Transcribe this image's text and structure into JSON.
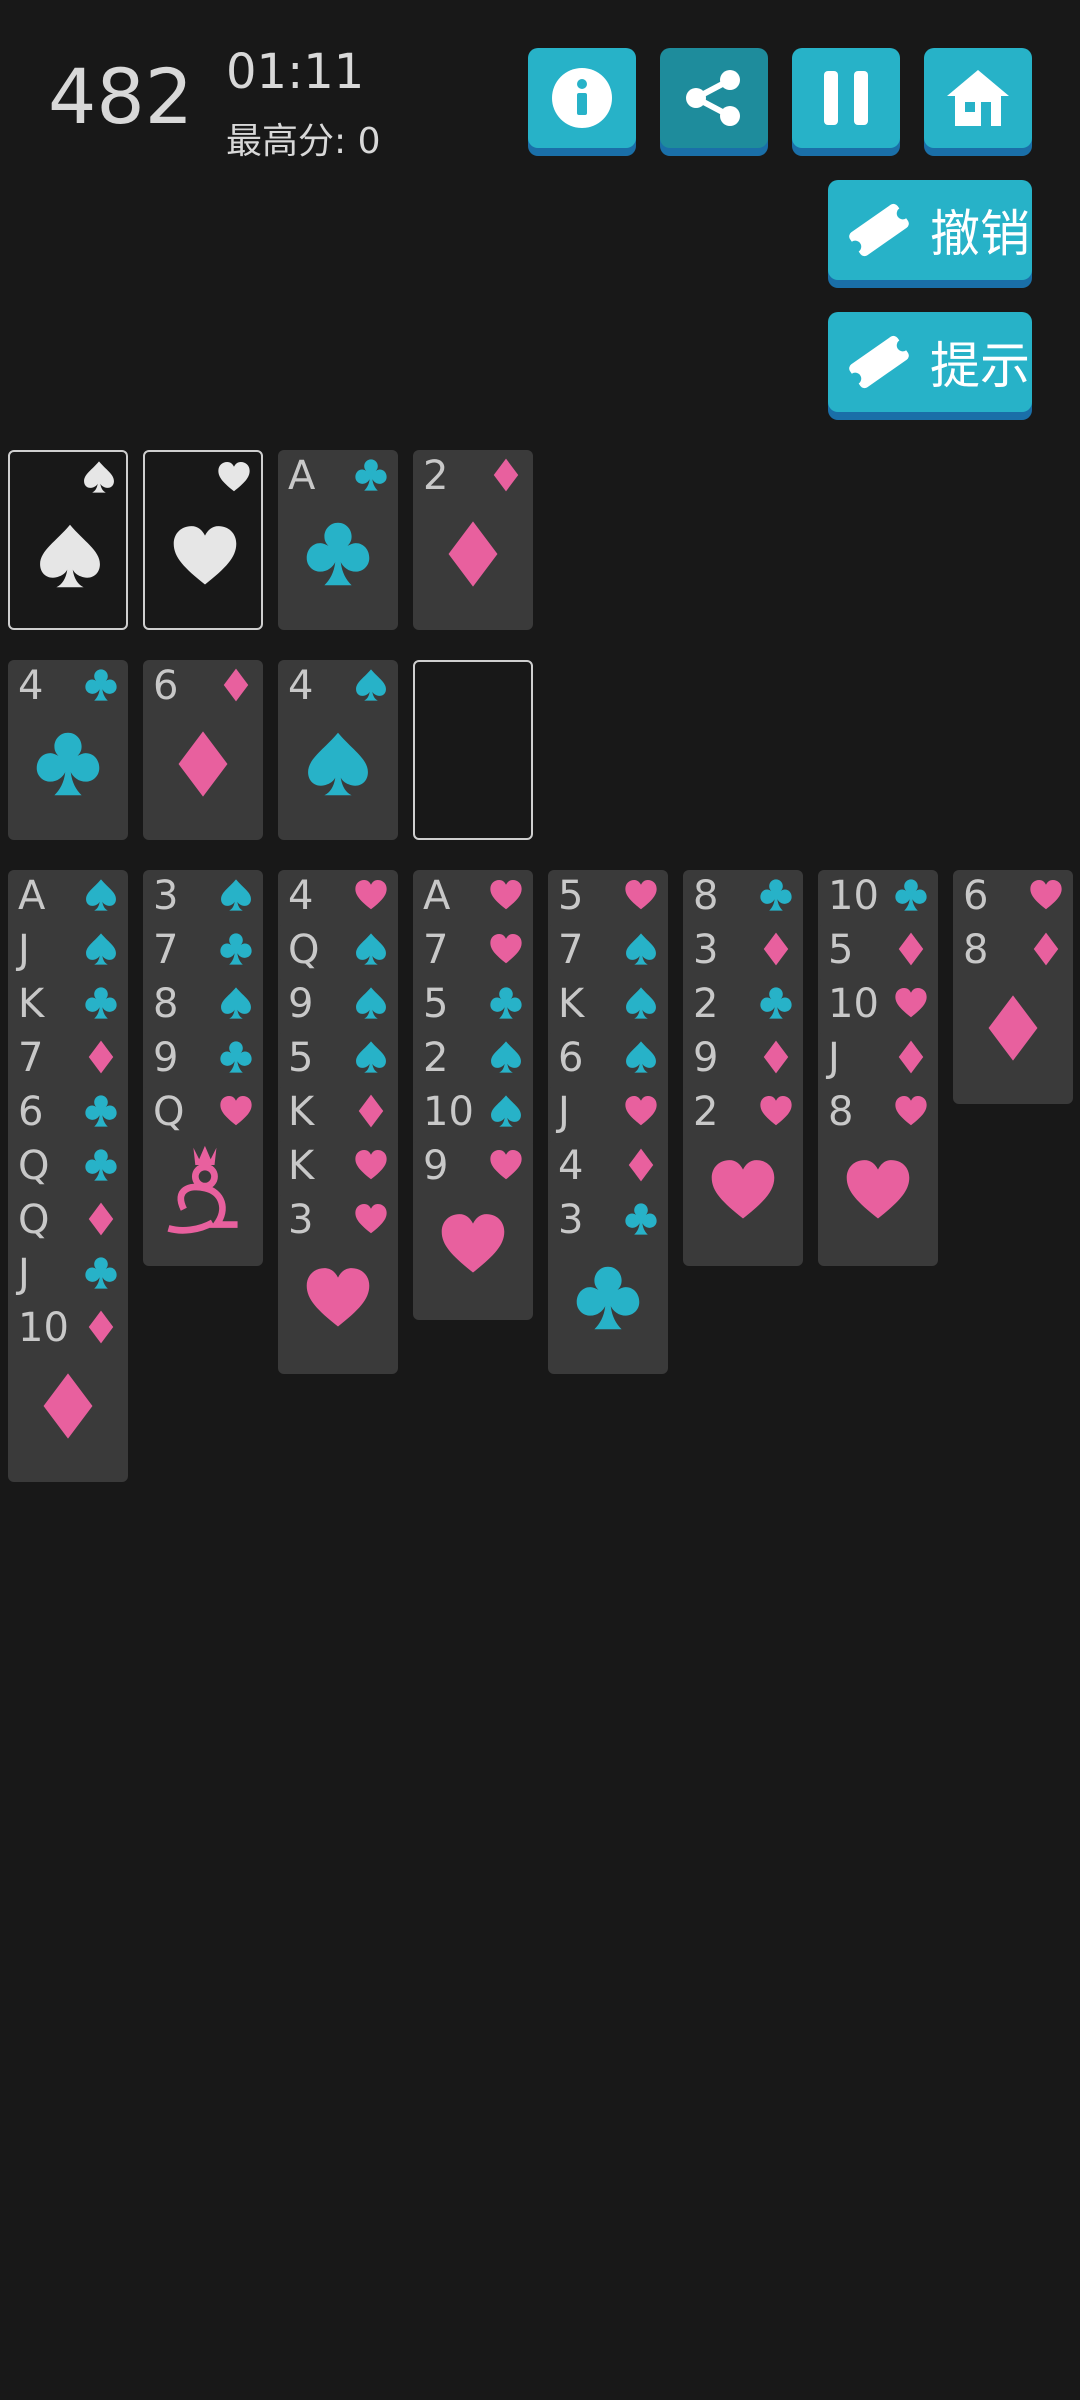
{
  "header": {
    "score": "482",
    "timer": "01:11",
    "best_score": "最高分:  0"
  },
  "toolbar": {
    "undo_label": "撤销",
    "hint_label": "提示"
  },
  "colors": {
    "teal": "#27b2c8",
    "pink": "#e8609e",
    "card": "#3a3a3a",
    "bg": "#181818"
  },
  "foundations": [
    {
      "rank": "",
      "suit": "spade",
      "placeholder": true
    },
    {
      "rank": "",
      "suit": "heart",
      "placeholder": true
    },
    {
      "rank": "A",
      "suit": "club"
    },
    {
      "rank": "2",
      "suit": "diamond"
    }
  ],
  "free_cells": [
    {
      "rank": "4",
      "suit": "club"
    },
    {
      "rank": "6",
      "suit": "diamond"
    },
    {
      "rank": "4",
      "suit": "spade"
    },
    {
      "empty": true
    }
  ],
  "tableau": [
    [
      {
        "rank": "A",
        "suit": "spade"
      },
      {
        "rank": "J",
        "suit": "spade"
      },
      {
        "rank": "K",
        "suit": "club"
      },
      {
        "rank": "7",
        "suit": "diamond"
      },
      {
        "rank": "6",
        "suit": "club"
      },
      {
        "rank": "Q",
        "suit": "club"
      },
      {
        "rank": "Q",
        "suit": "diamond"
      },
      {
        "rank": "J",
        "suit": "club"
      },
      {
        "rank": "10",
        "suit": "diamond"
      }
    ],
    [
      {
        "rank": "3",
        "suit": "spade"
      },
      {
        "rank": "7",
        "suit": "club"
      },
      {
        "rank": "8",
        "suit": "spade"
      },
      {
        "rank": "9",
        "suit": "club"
      },
      {
        "rank": "Q",
        "suit": "heart",
        "face": true
      }
    ],
    [
      {
        "rank": "4",
        "suit": "heart"
      },
      {
        "rank": "Q",
        "suit": "spade"
      },
      {
        "rank": "9",
        "suit": "spade"
      },
      {
        "rank": "5",
        "suit": "spade"
      },
      {
        "rank": "K",
        "suit": "diamond"
      },
      {
        "rank": "K",
        "suit": "heart"
      },
      {
        "rank": "3",
        "suit": "heart"
      }
    ],
    [
      {
        "rank": "A",
        "suit": "heart"
      },
      {
        "rank": "7",
        "suit": "heart"
      },
      {
        "rank": "5",
        "suit": "club"
      },
      {
        "rank": "2",
        "suit": "spade"
      },
      {
        "rank": "10",
        "suit": "spade"
      },
      {
        "rank": "9",
        "suit": "heart"
      }
    ],
    [
      {
        "rank": "5",
        "suit": "heart"
      },
      {
        "rank": "7",
        "suit": "spade"
      },
      {
        "rank": "K",
        "suit": "spade"
      },
      {
        "rank": "6",
        "suit": "spade"
      },
      {
        "rank": "J",
        "suit": "heart"
      },
      {
        "rank": "4",
        "suit": "diamond"
      },
      {
        "rank": "3",
        "suit": "club"
      }
    ],
    [
      {
        "rank": "8",
        "suit": "club"
      },
      {
        "rank": "3",
        "suit": "diamond"
      },
      {
        "rank": "2",
        "suit": "club"
      },
      {
        "rank": "9",
        "suit": "diamond"
      },
      {
        "rank": "2",
        "suit": "heart"
      }
    ],
    [
      {
        "rank": "10",
        "suit": "club"
      },
      {
        "rank": "5",
        "suit": "diamond"
      },
      {
        "rank": "10",
        "suit": "heart"
      },
      {
        "rank": "J",
        "suit": "diamond"
      },
      {
        "rank": "8",
        "suit": "heart"
      }
    ],
    [
      {
        "rank": "6",
        "suit": "heart"
      },
      {
        "rank": "8",
        "suit": "diamond"
      }
    ]
  ]
}
